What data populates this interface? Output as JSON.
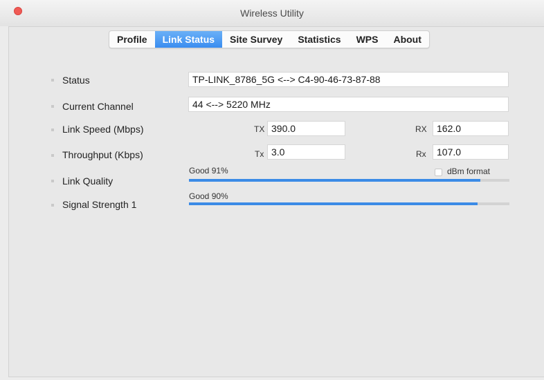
{
  "window": {
    "title": "Wireless Utility"
  },
  "tabs": [
    {
      "label": "Profile",
      "active": false
    },
    {
      "label": "Link Status",
      "active": true
    },
    {
      "label": "Site Survey",
      "active": false
    },
    {
      "label": "Statistics",
      "active": false
    },
    {
      "label": "WPS",
      "active": false
    },
    {
      "label": "About",
      "active": false
    }
  ],
  "status": {
    "label": "Status",
    "value": "TP-LINK_8786_5G <--> C4-90-46-73-87-88"
  },
  "channel": {
    "label": "Current Channel",
    "value": "44 <--> 5220 MHz"
  },
  "link_speed": {
    "label": "Link Speed (Mbps)",
    "tx_label": "TX",
    "tx_value": "390.0",
    "rx_label": "RX",
    "rx_value": "162.0"
  },
  "throughput": {
    "label": "Throughput (Kbps)",
    "tx_label": "Tx",
    "tx_value": "3.0",
    "rx_label": "Rx",
    "rx_value": "107.0"
  },
  "dbm_format": {
    "label": "dBm format",
    "checked": false
  },
  "link_quality": {
    "label": "Link Quality",
    "text": "Good 91%",
    "percent": 91
  },
  "signal_strength": {
    "label": "Signal Strength 1",
    "text": "Good 90%",
    "percent": 90
  },
  "colors": {
    "accent": "#3b8be6",
    "close": "#f05a55"
  }
}
